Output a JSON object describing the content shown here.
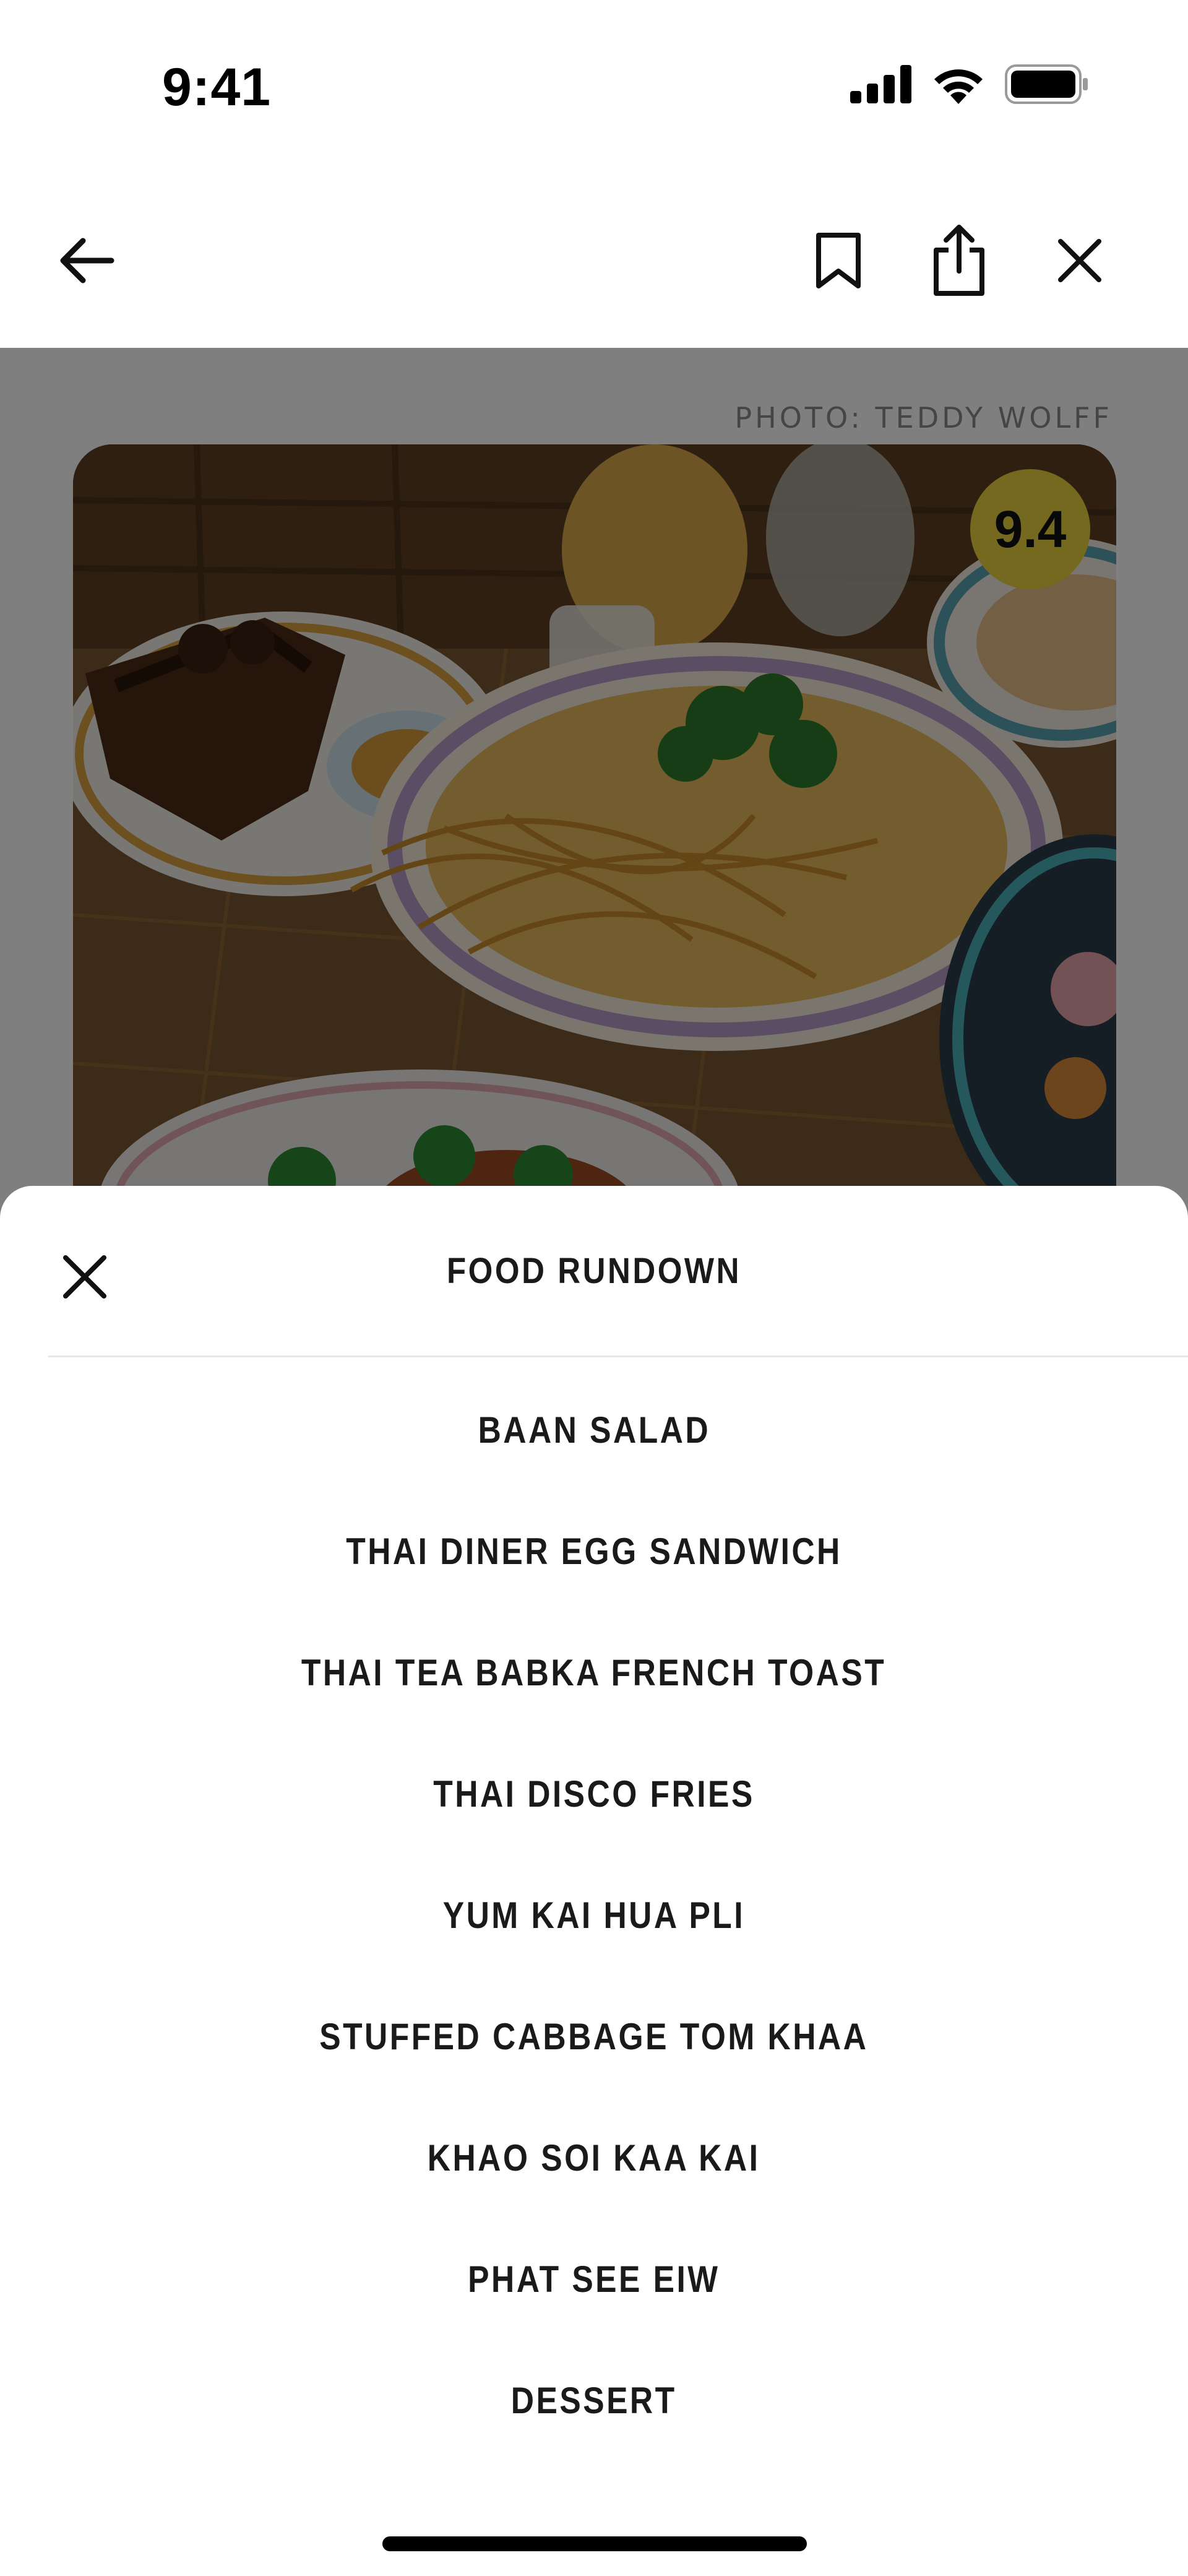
{
  "status_bar": {
    "time": "9:41",
    "icons": [
      "cellular-signal-icon",
      "wifi-icon",
      "battery-icon"
    ]
  },
  "nav": {
    "icons": [
      "arrow-left-icon",
      "bookmark-icon",
      "share-icon",
      "close-icon"
    ]
  },
  "hero": {
    "photo_credit": "PHOTO: TEDDY WOLFF",
    "score": "9.4"
  },
  "sheet": {
    "title": "FOOD RUNDOWN",
    "items": [
      "BAAN SALAD",
      "THAI DINER EGG SANDWICH",
      "THAI TEA BABKA FRENCH TOAST",
      "THAI DISCO FRIES",
      "YUM KAI HUA PLI",
      "STUFFED CABBAGE TOM KHAA",
      "KHAO SOI KAA KAI",
      "PHAT SEE EIW",
      "DESSERT"
    ]
  },
  "colors": {
    "score_badge": "#e8d23c",
    "overlay": "rgba(0,0,0,0.5)",
    "text_dark": "#1a1a1a"
  }
}
